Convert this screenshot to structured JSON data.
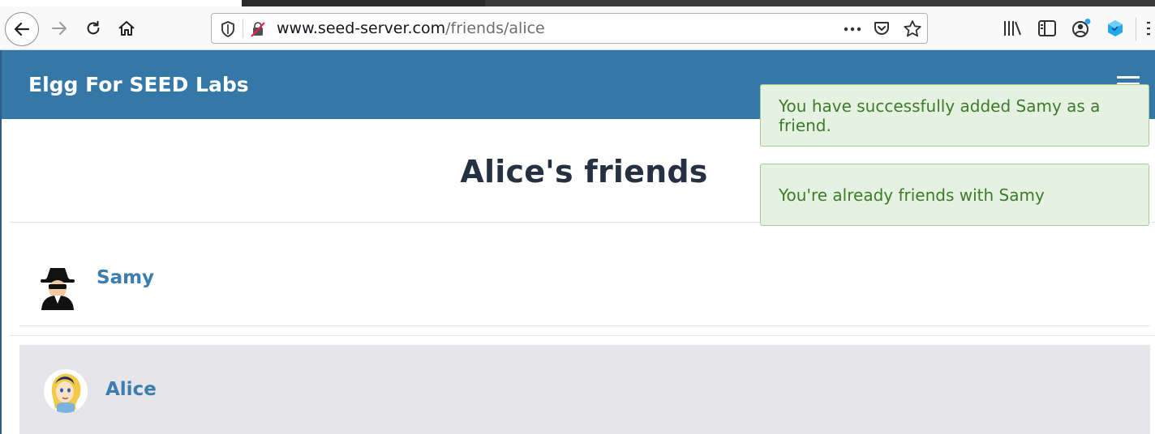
{
  "browser": {
    "url_host": "www.seed-server.com",
    "url_path": "/friends/alice"
  },
  "site": {
    "brand": "Elgg For SEED Labs"
  },
  "messages": [
    "You have successfully added Samy as a friend.",
    "You're already friends with Samy"
  ],
  "page": {
    "title": "Alice's friends"
  },
  "friends": [
    {
      "name": "Samy"
    },
    {
      "name": "Alice"
    }
  ],
  "colors": {
    "header": "#3577a6",
    "success_bg": "#e6f2e1",
    "success_text": "#3d7a2a",
    "link": "#3a7dae"
  }
}
